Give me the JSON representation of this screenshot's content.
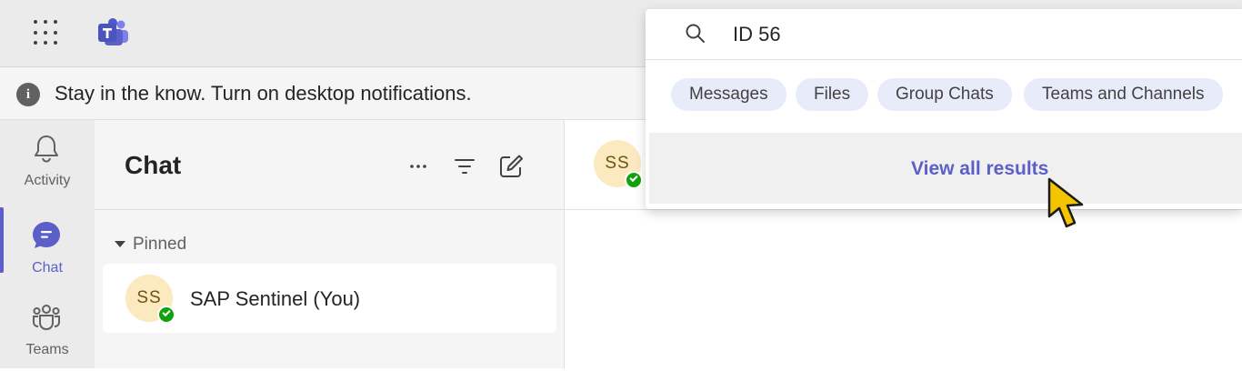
{
  "colors": {
    "accent": "#5b5fc7",
    "presence": "#13a10e",
    "avatar_bg": "#fbe9bf",
    "pill_bg": "#e8ebfa"
  },
  "topbar": {
    "apps_icon": "app-launcher-icon",
    "logo_icon": "teams-logo-icon"
  },
  "search": {
    "query": "ID 56",
    "icon": "search-icon",
    "filters": [
      {
        "label": "Messages"
      },
      {
        "label": "Files"
      },
      {
        "label": "Group Chats"
      },
      {
        "label": "Teams and Channels"
      }
    ],
    "view_all": "View all results"
  },
  "notification": {
    "icon": "info-icon",
    "text": "Stay in the know. Turn on desktop notifications."
  },
  "rail": {
    "items": [
      {
        "label": "Activity",
        "icon": "bell-icon"
      },
      {
        "label": "Chat",
        "icon": "chat-icon",
        "active": true
      },
      {
        "label": "Teams",
        "icon": "teams-icon"
      }
    ]
  },
  "chat_list": {
    "title": "Chat",
    "more_icon": "more-icon",
    "filter_icon": "filter-icon",
    "compose_icon": "compose-icon",
    "section": "Pinned",
    "items": [
      {
        "initials": "SS",
        "name": "SAP Sentinel (You)",
        "status": "available"
      }
    ]
  },
  "conversation": {
    "avatar_initials": "SS"
  }
}
